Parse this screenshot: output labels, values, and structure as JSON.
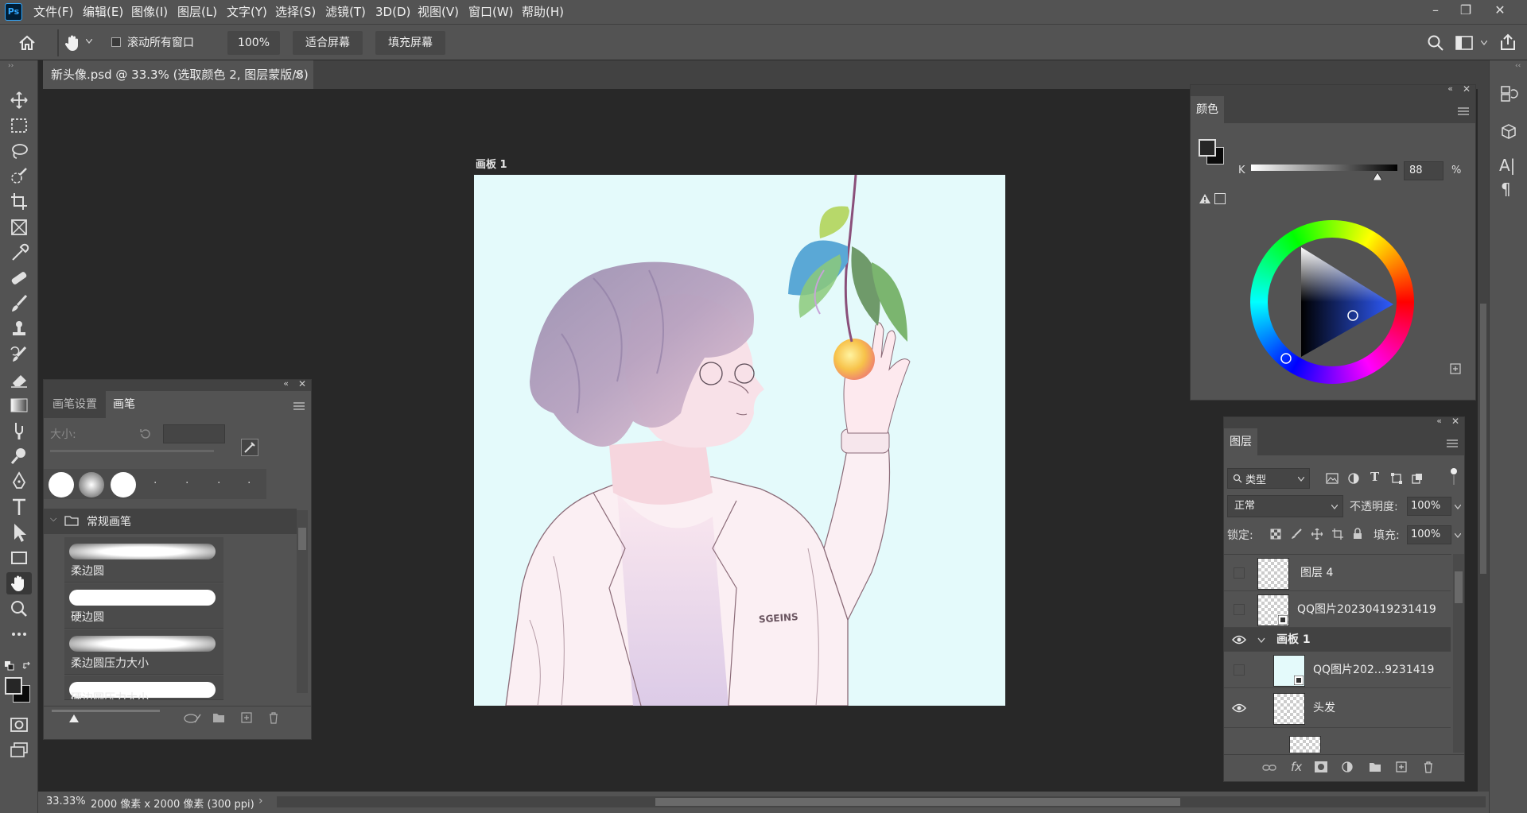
{
  "app": {
    "logo": "Ps"
  },
  "menu": [
    "文件(F)",
    "编辑(E)",
    "图像(I)",
    "图层(L)",
    "文字(Y)",
    "选择(S)",
    "滤镜(T)",
    "3D(D)",
    "视图(V)",
    "窗口(W)",
    "帮助(H)"
  ],
  "options": {
    "scroll_all_label": "滚动所有窗口",
    "zoom_value": "100%",
    "fit_screen": "适合屏幕",
    "fill_screen": "填充屏幕"
  },
  "document": {
    "tab_title": "新头像.psd @ 33.3% (选取颜色 2, 图层蒙版/8)",
    "tab_close": "×",
    "artboard_label": "画板 1"
  },
  "brush_panel": {
    "tabs": [
      "画笔设置",
      "画笔"
    ],
    "size_label": "大小:",
    "group_name": "常规画笔",
    "brushes": [
      "柔边圆",
      "硬边圆",
      "柔边圆压力大小",
      "硬边圆压力大小"
    ]
  },
  "color_panel": {
    "tab": "颜色",
    "channel": "K",
    "value": "88",
    "unit": "%"
  },
  "layers_panel": {
    "tab": "图层",
    "filter_type": "类型",
    "blend_mode": "正常",
    "opacity_label": "不透明度:",
    "opacity_value": "100%",
    "lock_label": "锁定:",
    "fill_label": "填充:",
    "fill_value": "100%",
    "layers": [
      {
        "name": "图层 4",
        "visible": false
      },
      {
        "name": "QQ图片20230419231419",
        "visible": false
      },
      {
        "name": "画板 1",
        "visible": true,
        "group": true
      },
      {
        "name": "QQ图片202...9231419",
        "visible": false
      },
      {
        "name": "头发",
        "visible": true
      }
    ]
  },
  "status": {
    "zoom": "33.33%",
    "doc_info": "2000 像素 x 2000 像素 (300 ppi)",
    "arrow": "›"
  },
  "colors": {
    "chrome": "#535353",
    "workspace": "#282828",
    "canvas_bg": "#e4fafb",
    "accent": "#31a8ff"
  }
}
